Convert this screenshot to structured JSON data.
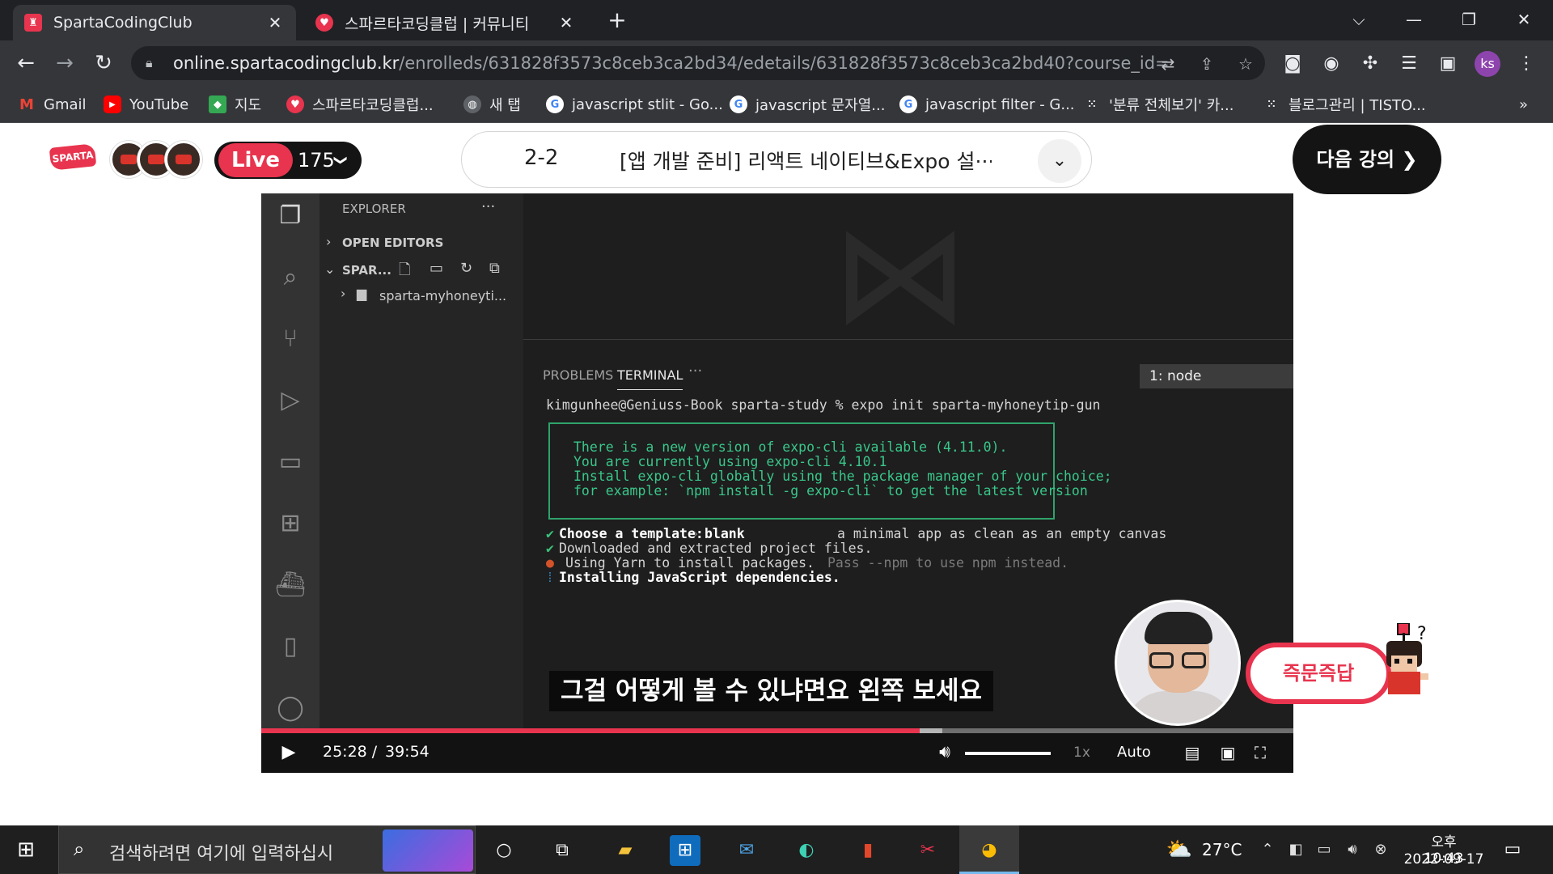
{
  "browser": {
    "tabs": [
      {
        "title": "SpartaCodingClub",
        "icon": "sparta-favicon",
        "active": true
      },
      {
        "title": "스파르타코딩클럽 | 커뮤니티",
        "icon": "sparta-heart-favicon",
        "active": false
      }
    ],
    "new_tab_glyph": "+",
    "window_controls": {
      "tab_search": "⌵",
      "minimize": "—",
      "restore": "❐",
      "close": "✕"
    },
    "nav": {
      "back": "←",
      "forward": "→",
      "reload": "↻"
    },
    "url_host": "online.spartacodingclub.kr",
    "url_path": "/enrolleds/631828f3573c8ceb3ca2bd34/edetails/631828f3573c8ceb3ca2bd40?course_id=616d434...",
    "profile_initials": "ks",
    "bookmarks": [
      {
        "label": "Gmail",
        "icon": "gmail-icon",
        "glyph": "M",
        "color": "#ea4335"
      },
      {
        "label": "YouTube",
        "icon": "youtube-icon",
        "glyph": "▶",
        "color": "#ff0000"
      },
      {
        "label": "지도",
        "icon": "maps-icon",
        "glyph": "◆",
        "color": "#34a853"
      },
      {
        "label": "스파르타코딩클럽...",
        "icon": "sparta-heart-icon",
        "glyph": "♥",
        "color": "#e8344e"
      },
      {
        "label": "새 탭",
        "icon": "globe-icon",
        "glyph": "◍",
        "color": "#9aa0a6"
      },
      {
        "label": "javascript stlit - Go...",
        "icon": "google-icon",
        "glyph": "G",
        "color": "#4285f4"
      },
      {
        "label": "javascript 문자열...",
        "icon": "google-icon",
        "glyph": "G",
        "color": "#4285f4"
      },
      {
        "label": "javascript filter - G...",
        "icon": "google-icon",
        "glyph": "G",
        "color": "#4285f4"
      },
      {
        "label": "'분류 전체보기' 카...",
        "icon": "tistory-icon",
        "glyph": "⁙",
        "color": "#35363a"
      },
      {
        "label": "블로그관리 | TISTO...",
        "icon": "tistory-icon",
        "glyph": "⁙",
        "color": "#35363a"
      }
    ],
    "bookmarks_overflow": "»"
  },
  "header": {
    "logo_text": "SPARTA",
    "live_label": "Live",
    "live_count": "175",
    "live_chevron": "❯",
    "lesson_number": "2-2",
    "lesson_title": "[앱 개발 준비] 리액트 네이티브&Expo 설···",
    "lesson_chevron": "⌄",
    "next_button": "다음 강의  ❯"
  },
  "vscode": {
    "explorer_title": "EXPLORER",
    "explorer_more": "···",
    "open_editors": "OPEN EDITORS",
    "workspace": "SPAR...",
    "folder": "sparta-myhoneyti...",
    "panel_tabs": [
      "PROBLEMS",
      "TERMINAL",
      "···"
    ],
    "terminal_select": "1: node",
    "terminal": {
      "prompt": "kimgunhee@Geniuss-Book sparta-study % expo init sparta-myhoneytip-gun",
      "notice": [
        "There is a new version of expo-cli available (4.11.0).",
        "You are currently using expo-cli 4.10.1",
        "Install expo-cli globally using the package manager of your choice;",
        "for example: `npm install -g expo-cli` to get the latest version"
      ],
      "line_template_label": "Choose a template:",
      "line_template_value": "blank",
      "line_template_desc": "a minimal app as clean as an empty canvas",
      "line_downloaded": "Downloaded and extracted project files.",
      "line_yarn_a": "Using Yarn to install packages.",
      "line_yarn_b": "Pass --npm to use npm instead.",
      "line_installing": "Installing JavaScript dependencies."
    }
  },
  "video": {
    "caption": "그걸 어떻게 볼 수 있냐면요 왼쪽 보세요",
    "qa_badge": "즉문즉답",
    "current_time": "25:28 /",
    "duration": "39:54",
    "progress_fraction": 0.638,
    "buffered_fraction": 0.66,
    "speed": "1x",
    "quality": "Auto"
  },
  "taskbar": {
    "search_placeholder": "검색하려면 여기에 입력하십시",
    "temperature": "27°C",
    "time": "오후 10:43",
    "date": "2022-09-17"
  },
  "colors": {
    "brand_red": "#e8344e",
    "terminal_green": "#2fa36b",
    "chrome_dark": "#202124",
    "chrome_toolbar": "#35363a"
  }
}
